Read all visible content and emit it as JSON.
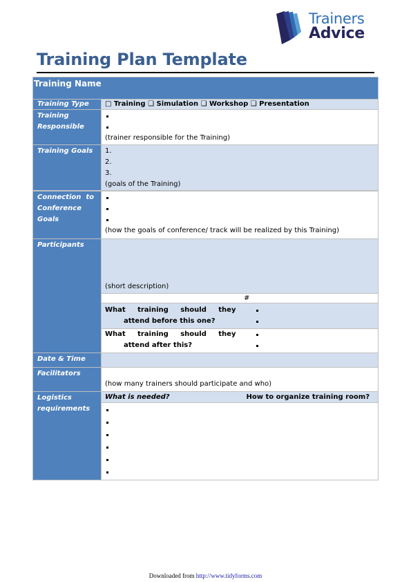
{
  "logo": {
    "line1": "Trainers",
    "line2": "Advice"
  },
  "title": "Training Plan Template",
  "table": {
    "training_name_label": "Training Name",
    "training_type": {
      "label": "Training Type",
      "options": [
        "□ Training",
        "❏ Simulation",
        "❏ Workshop",
        "❏ Presentation"
      ]
    },
    "training_responsible": {
      "label_lines": [
        "Training",
        "Responsible"
      ],
      "bullets": 2,
      "hint": "(trainer responsible for the Training)"
    },
    "training_goals": {
      "label": "Training Goals",
      "items": [
        "1.",
        "2.",
        "3."
      ],
      "hint": "(goals of the Training)"
    },
    "connection": {
      "label_lines": [
        "Connection  to",
        "Conference",
        "Goals"
      ],
      "bullets": 3,
      "hint": "(how the goals of conference/ track will be realized by this Training)"
    },
    "participants": {
      "label": "Participants",
      "hint": "(short description)",
      "count_header": "#",
      "before_question_lines": [
        "What     training     should     they",
        "attend before this one?"
      ],
      "after_question_lines": [
        "What     training     should     they",
        "attend after this?"
      ]
    },
    "date_time": {
      "label": "Date & Time"
    },
    "facilitators": {
      "label": "Facilitators",
      "hint": "(how many trainers should participate and who)"
    },
    "logistics": {
      "label_lines": [
        "Logistics",
        "requirements"
      ],
      "col1_header": "What is needed?",
      "col2_header": "How to organize training room?",
      "bullets": 6
    }
  },
  "footer": {
    "prefix": "Downloaded from ",
    "link": "http://www.tidyforms.com"
  }
}
